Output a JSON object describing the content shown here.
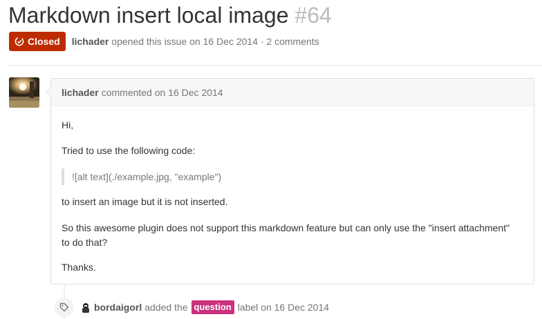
{
  "issue": {
    "title": "Markdown insert local image",
    "number": "#64",
    "state": "Closed",
    "author": "lichader",
    "opened_text": "opened this issue on 16 Dec 2014 · 2 comments"
  },
  "comment": {
    "author": "lichader",
    "meta": "commented on 16 Dec 2014",
    "paragraphs": [
      "Hi,",
      "Tried to use the following code:",
      "to insert an image but it is not inserted.",
      "So this awesome plugin does not support this markdown feature but can only use the \"insert attachment\"",
      "to do that?",
      "Thanks."
    ],
    "quote": "![alt text](./example.jpg, \"example\")"
  },
  "event": {
    "author": "bordaigorl",
    "action": "added the",
    "label": "question",
    "suffix": "label on 16 Dec 2014",
    "icon": "tag-icon"
  },
  "colors": {
    "closed_badge": "#bd2c00",
    "label_question": "#cc317c"
  }
}
